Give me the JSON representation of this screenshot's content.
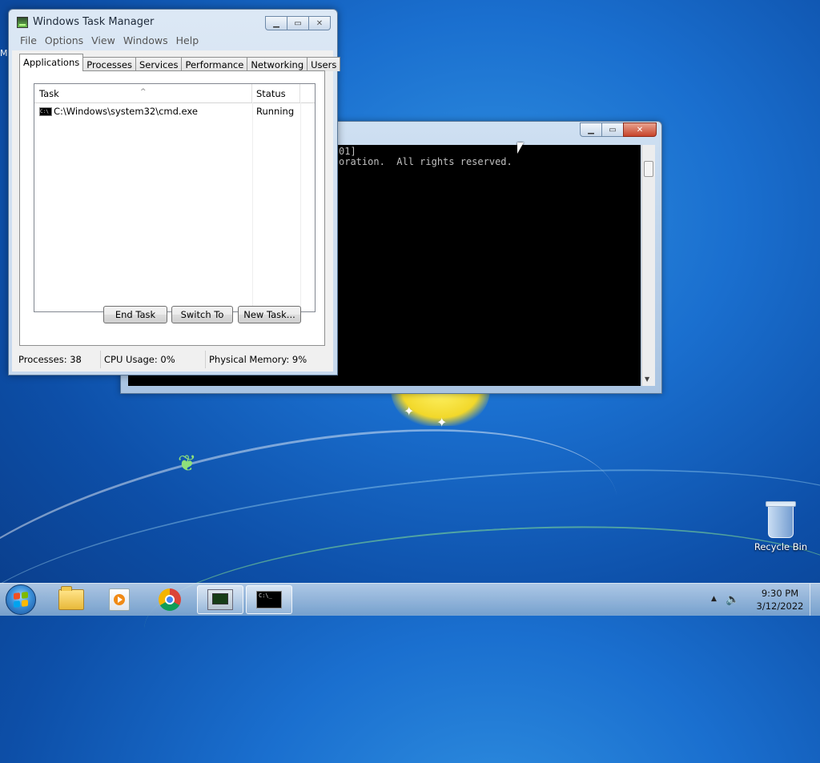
{
  "taskmanager": {
    "title": "Windows Task Manager",
    "menu": [
      "File",
      "Options",
      "View",
      "Windows",
      "Help"
    ],
    "tabs": [
      "Applications",
      "Processes",
      "Services",
      "Performance",
      "Networking",
      "Users"
    ],
    "active_tab": "Applications",
    "columns": {
      "task": "Task",
      "status": "Status"
    },
    "rows": [
      {
        "task": "C:\\Windows\\system32\\cmd.exe",
        "status": "Running"
      }
    ],
    "buttons": {
      "end_task": "End Task",
      "switch_to": "Switch To",
      "new_task": "New Task..."
    },
    "statusbar": {
      "processes": "Processes: 38",
      "cpu": "CPU Usage: 0%",
      "memory": "Physical Memory: 9%"
    }
  },
  "console": {
    "lines": [
      "01]",
      "oration.  All rights reserved."
    ]
  },
  "desktop": {
    "recycle_bin_label": "Recycle Bin",
    "left_edge_text": "M"
  },
  "taskbar": {
    "items": [
      "windows-explorer-icon",
      "media-player-icon",
      "chrome-icon",
      "task-manager-icon",
      "command-prompt-icon"
    ],
    "cmd_icon_text": "C:\\_",
    "clock": {
      "time": "9:30 PM",
      "date": "3/12/2022"
    }
  },
  "colors": {
    "desktop_blue": "#1a6fcf",
    "close_red": "#c7432a",
    "console_bg": "#000000"
  }
}
